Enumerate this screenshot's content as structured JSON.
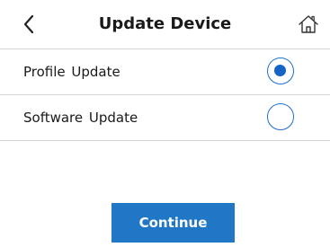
{
  "header": {
    "title": "Update Device",
    "back_icon": "chevron-left-icon",
    "home_icon": "home-icon"
  },
  "options": [
    {
      "label": "Profile Update",
      "selected": true
    },
    {
      "label": "Software Update",
      "selected": false
    }
  ],
  "actions": {
    "continue_label": "Continue"
  },
  "colors": {
    "accent": "#1f77c6",
    "radio_border": "#1f6fd0",
    "divider": "#d6d6d6"
  }
}
